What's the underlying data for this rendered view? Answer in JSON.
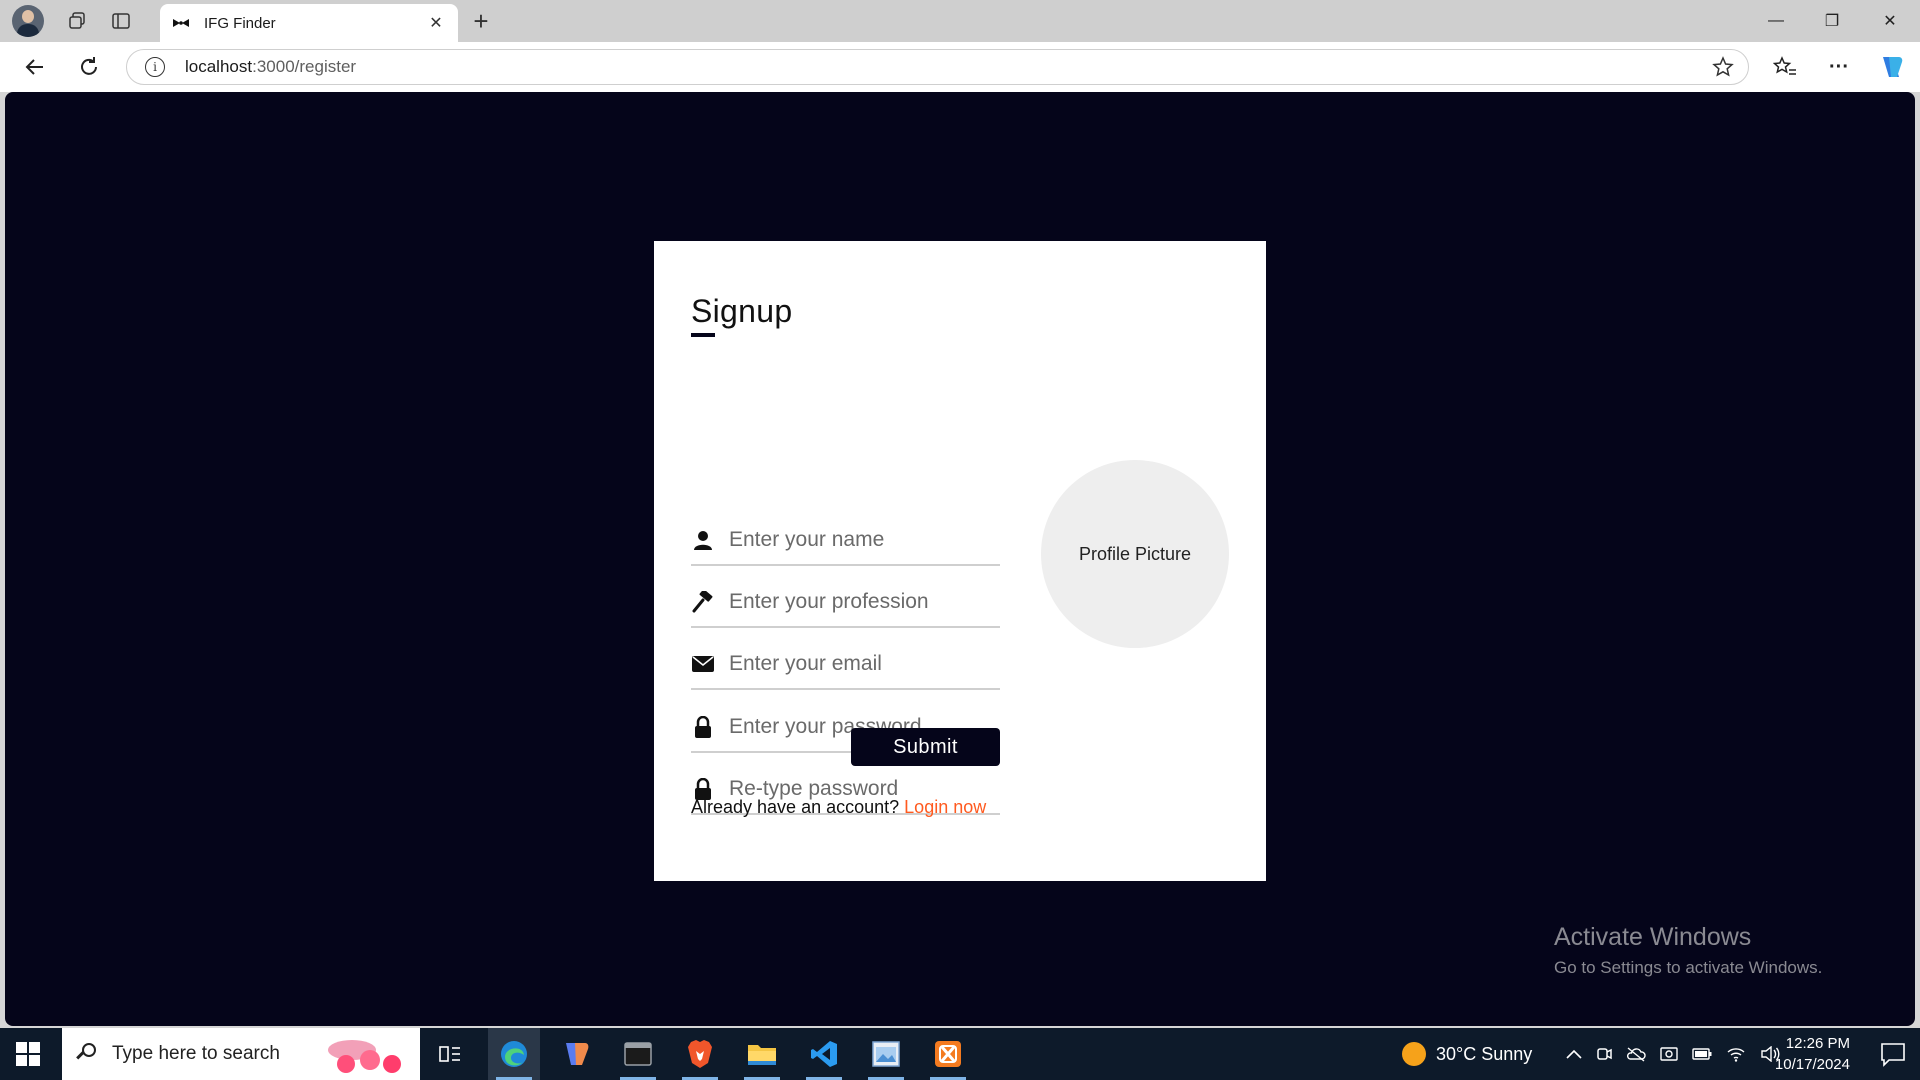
{
  "browser": {
    "tab_title": "IFG Finder",
    "tab_close": "✕",
    "new_tab": "+",
    "window_controls": {
      "minimize": "—",
      "restore": "❐",
      "close": "✕"
    },
    "url_host": "localhost",
    "url_path": ":3000/register",
    "more_menu": "···"
  },
  "page": {
    "title": "Signup",
    "fields": [
      {
        "placeholder": "Enter your name",
        "icon": "user-icon"
      },
      {
        "placeholder": "Enter your profession",
        "icon": "hammer-icon"
      },
      {
        "placeholder": "Enter your email",
        "icon": "envelope-icon"
      },
      {
        "placeholder": "Enter your password",
        "icon": "lock-icon"
      },
      {
        "placeholder": "Re-type password",
        "icon": "lock-icon"
      }
    ],
    "profile_picture_label": "Profile Picture",
    "submit_label": "Submit",
    "already_text": "Already have an account?",
    "login_link": "Login now"
  },
  "watermark": {
    "line1": "Activate Windows",
    "line2": "Go to Settings to activate Windows."
  },
  "taskbar": {
    "search_placeholder": "Type here to search",
    "weather": "30°C  Sunny",
    "time": "12:26 PM",
    "date": "10/17/2024"
  },
  "colors": {
    "page_background": "#05051a",
    "card_background": "#ffffff",
    "accent_link": "#ff5a1f",
    "button": "#05051a"
  }
}
